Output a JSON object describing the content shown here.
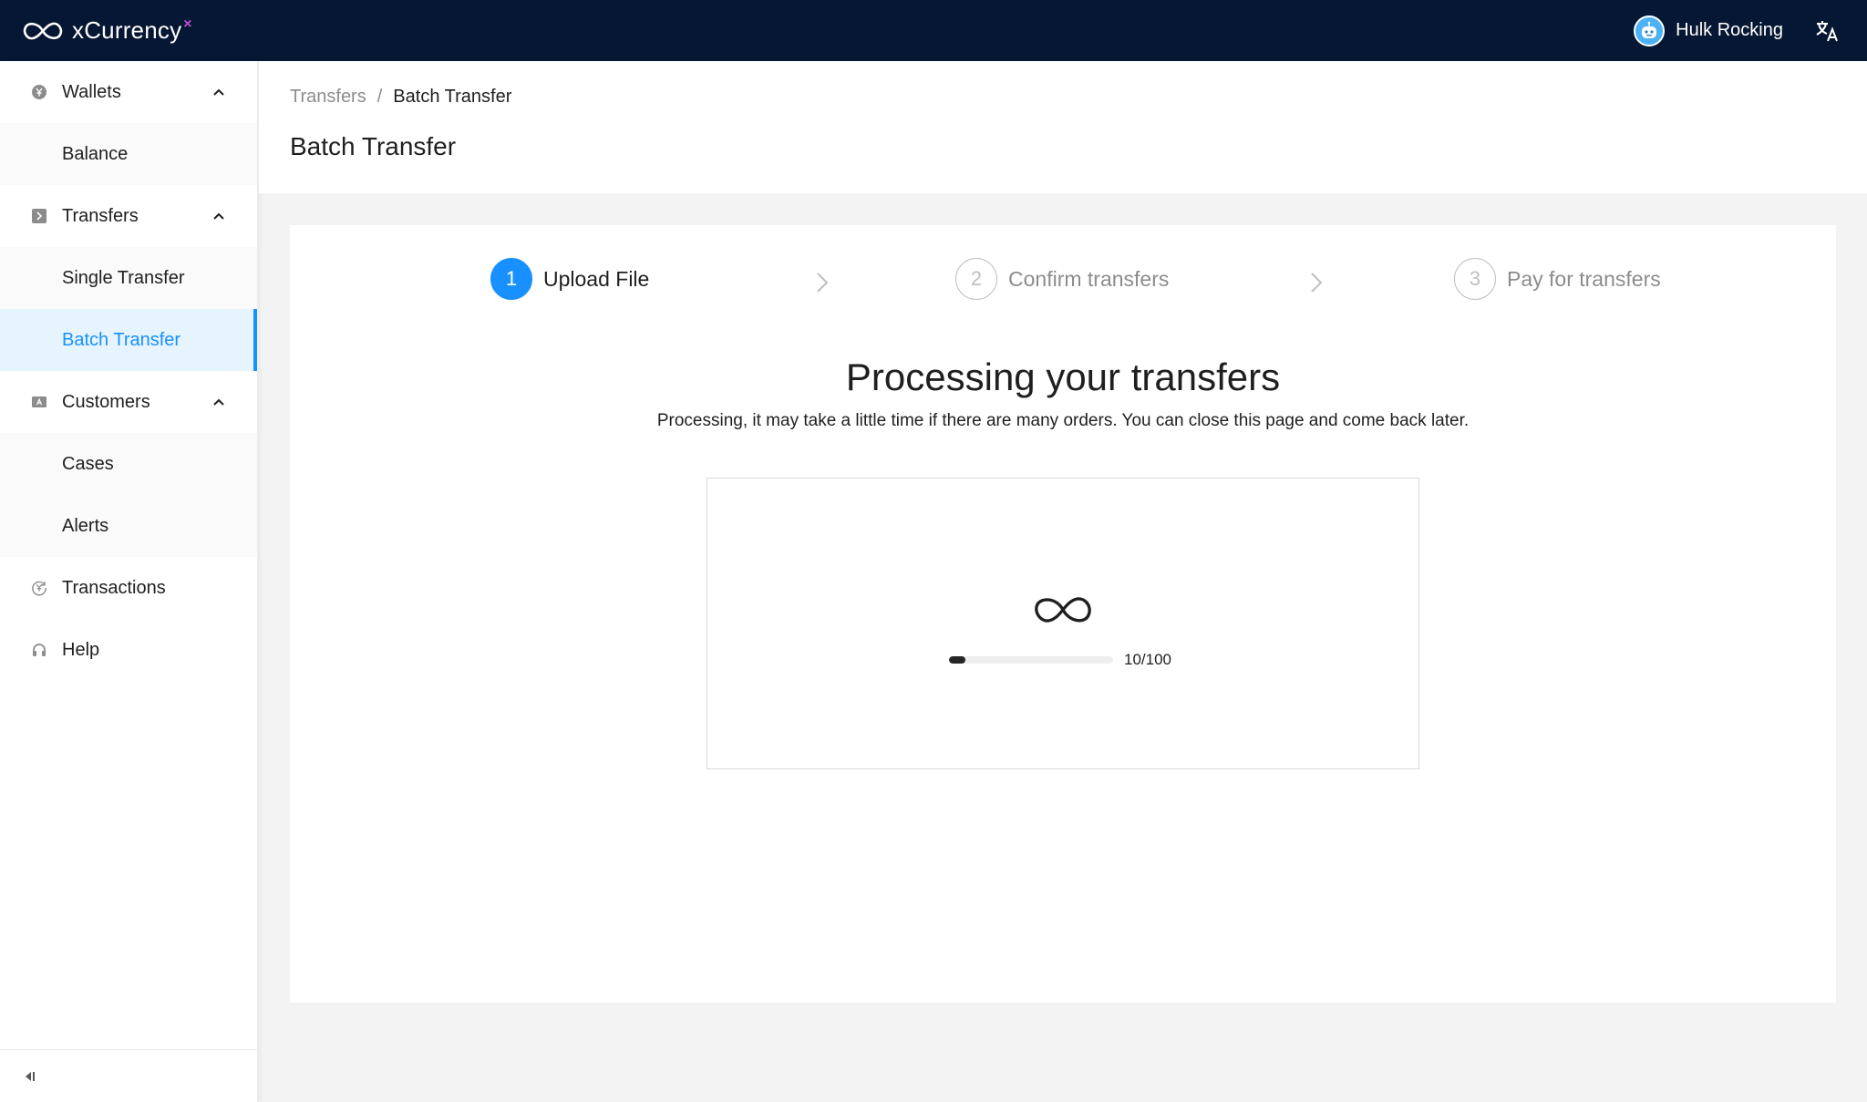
{
  "app": {
    "brand_name": "xCurrency",
    "brand_mark": "×",
    "user_name": "Hulk Rocking"
  },
  "colors": {
    "topbar": "#061733",
    "accent": "#1890ff",
    "brand_mark": "#c04fd8"
  },
  "sidebar": {
    "wallets": {
      "label": "Wallets",
      "icon": "yen-circle-icon",
      "items": [
        "Balance"
      ]
    },
    "transfers": {
      "label": "Transfers",
      "icon": "transfer-icon",
      "items": [
        "Single Transfer",
        "Batch Transfer"
      ]
    },
    "customers": {
      "label": "Customers",
      "icon": "id-card-icon",
      "items": [
        "Cases",
        "Alerts"
      ]
    },
    "transactions": {
      "label": "Transactions",
      "icon": "transaction-icon"
    },
    "help": {
      "label": "Help",
      "icon": "headphones-icon"
    },
    "active_item": "Batch Transfer"
  },
  "breadcrumb": {
    "parent": "Transfers",
    "separator": "/",
    "current": "Batch Transfer"
  },
  "page": {
    "title": "Batch Transfer"
  },
  "steps": [
    {
      "num": "1",
      "label": "Upload File",
      "state": "current"
    },
    {
      "num": "2",
      "label": "Confirm transfers",
      "state": "waiting"
    },
    {
      "num": "3",
      "label": "Pay for transfers",
      "state": "waiting"
    }
  ],
  "processing": {
    "title": "Processing your transfers",
    "description": "Processing, it may take a little time if there are many orders. You can close this page and come back later.",
    "progress_done": 10,
    "progress_total": 100,
    "progress_text": "10/100"
  }
}
